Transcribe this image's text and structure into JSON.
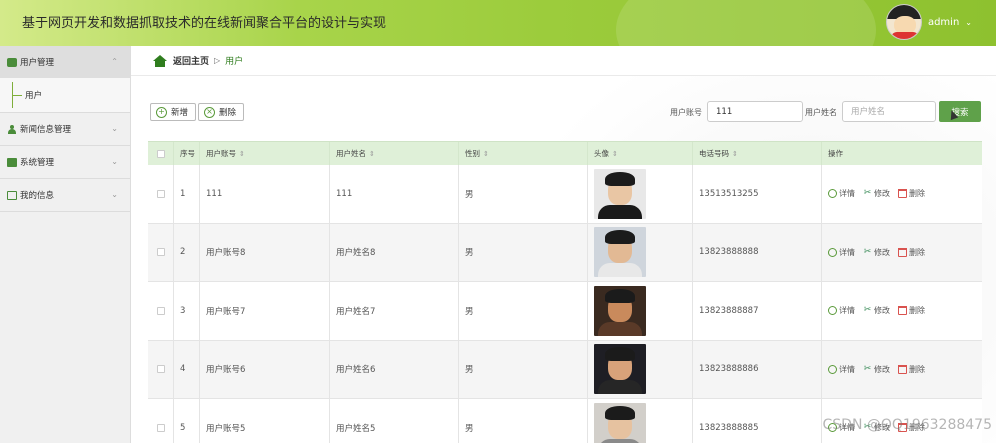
{
  "header": {
    "title": "基于网页开发和数据抓取技术的在线新闻聚合平台的设计与实现",
    "user": "admin",
    "caret": "⌄"
  },
  "sidebar": {
    "groups": [
      {
        "label": "用户管理",
        "icon": "chat-icon",
        "chevron": "⌃"
      },
      {
        "label": "新闻信息管理",
        "icon": "person-icon",
        "chevron": "⌄"
      },
      {
        "label": "系统管理",
        "icon": "box-icon",
        "chevron": "⌄"
      },
      {
        "label": "我的信息",
        "icon": "card-icon",
        "chevron": "⌄"
      }
    ],
    "sub_items": [
      {
        "label": "用户"
      }
    ]
  },
  "breadcrumb": {
    "home": "返回主页",
    "sep": "▷",
    "current": "用户"
  },
  "toolbar": {
    "add_label": "新增",
    "delete_label": "删除",
    "add_glyph": "+",
    "delete_glyph": "×"
  },
  "search": {
    "account_label": "用户账号",
    "account_value": "111",
    "name_label": "用户姓名",
    "name_placeholder": "用户姓名",
    "button": "搜索"
  },
  "table": {
    "sort_glyph": "⇕",
    "headers": [
      "序号",
      "用户账号",
      "用户姓名",
      "性别",
      "头像",
      "电话号码",
      "操作"
    ],
    "actions": {
      "detail": "详情",
      "edit": "修改",
      "delete": "删除"
    },
    "rows": [
      {
        "index": "1",
        "account": "111",
        "name": "111",
        "gender": "男",
        "phone": "13513513255"
      },
      {
        "index": "2",
        "account": "用户账号8",
        "name": "用户姓名8",
        "gender": "男",
        "phone": "13823888888"
      },
      {
        "index": "3",
        "account": "用户账号7",
        "name": "用户姓名7",
        "gender": "男",
        "phone": "13823888887"
      },
      {
        "index": "4",
        "account": "用户账号6",
        "name": "用户姓名6",
        "gender": "男",
        "phone": "13823888886"
      },
      {
        "index": "5",
        "account": "用户账号5",
        "name": "用户姓名5",
        "gender": "男",
        "phone": "13823888885"
      }
    ]
  },
  "watermark": "CSDN @QQ1963288475",
  "colors": {
    "accent": "#5fa14a",
    "header_green": "#9ccc3c",
    "table_head": "#dff0d8",
    "delete_red": "#d9534f"
  }
}
